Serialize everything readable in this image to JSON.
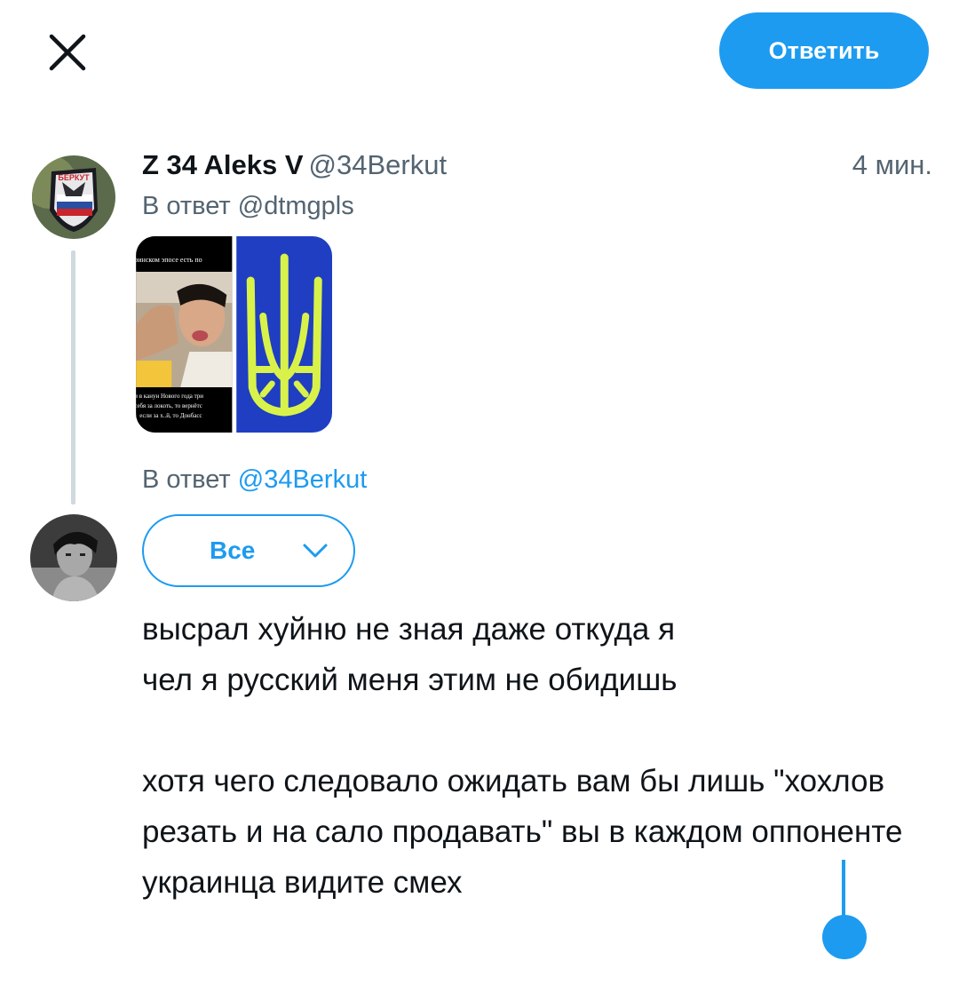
{
  "top_bar": {
    "close_icon": "close-icon",
    "reply_button_label": "Ответить"
  },
  "original_tweet": {
    "display_name": "Z 34 Aleks V",
    "handle": "@34Berkut",
    "timestamp": "4 мин.",
    "reply_to_prefix": "В ответ",
    "reply_to_handle": "@dtmgpls",
    "media": {
      "image1_lines_top": "ринском эпосе есть по",
      "image1_lines_bottom": [
        "и в канун Нового года три",
        "себя за локоть, то вернётс",
        "если за х..й, то Донбасс"
      ]
    }
  },
  "reply_composer": {
    "reply_to_prefix": "В ответ",
    "reply_to_handle": "@34Berkut",
    "audience_label": "Все",
    "text": "высрал хуйню не зная даже откуда я\nчел я русский меня этим не обидишь\n\nхотя чего следовало ожидать вам бы лишь \"хохлов резать и на сало продавать\" вы в каждом оппоненте украинца видите смех"
  },
  "colors": {
    "accent": "#1d9bf0",
    "secondary_text": "#536471",
    "thread_line": "#cfd9de"
  }
}
